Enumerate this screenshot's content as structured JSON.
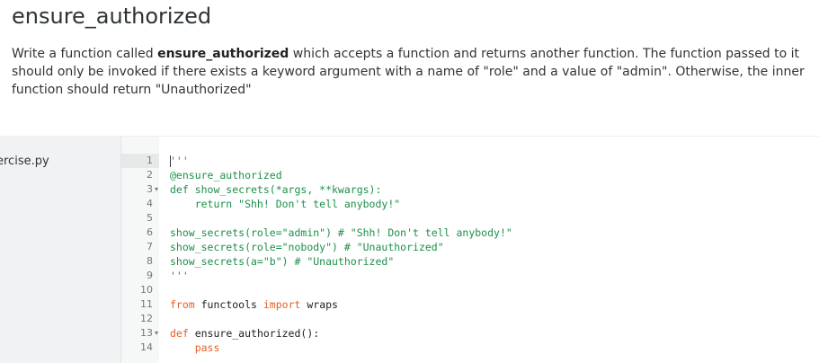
{
  "header": {
    "title": "ensure_authorized",
    "desc_prefix": "Write a function called ",
    "desc_bold": "ensure_authorized",
    "desc_rest": " which accepts a function and returns another function. The function passed to it should only be invoked if there exists a keyword argument with a name of \"role\" and a value of \"admin\". Otherwise, the inner function should return \"Unauthorized\""
  },
  "sidebar": {
    "file_name": "ercise.py"
  },
  "editor": {
    "active_line": 1,
    "lines": [
      {
        "n": "1",
        "fold": "",
        "segs": [
          {
            "t": "'''",
            "c": "g"
          }
        ]
      },
      {
        "n": "2",
        "fold": "",
        "segs": [
          {
            "t": "@ensure_authorized",
            "c": "g"
          }
        ]
      },
      {
        "n": "3",
        "fold": "▾",
        "segs": [
          {
            "t": "def show_secrets(*args, **kwargs):",
            "c": "g"
          }
        ]
      },
      {
        "n": "4",
        "fold": "",
        "segs": [
          {
            "t": "    return \"Shh! Don't tell anybody!\"",
            "c": "g"
          }
        ]
      },
      {
        "n": "5",
        "fold": "",
        "segs": []
      },
      {
        "n": "6",
        "fold": "",
        "segs": [
          {
            "t": "show_secrets(role=\"admin\") # \"Shh! Don't tell anybody!\"",
            "c": "g"
          }
        ]
      },
      {
        "n": "7",
        "fold": "",
        "segs": [
          {
            "t": "show_secrets(role=\"nobody\") # \"Unauthorized\"",
            "c": "g"
          }
        ]
      },
      {
        "n": "8",
        "fold": "",
        "segs": [
          {
            "t": "show_secrets(a=\"b\") # \"Unauthorized\"",
            "c": "g"
          }
        ]
      },
      {
        "n": "9",
        "fold": "",
        "segs": [
          {
            "t": "'''",
            "c": "g"
          }
        ]
      },
      {
        "n": "10",
        "fold": "",
        "segs": []
      },
      {
        "n": "11",
        "fold": "",
        "segs": [
          {
            "t": "from",
            "c": "o"
          },
          {
            "t": " functools ",
            "c": "k"
          },
          {
            "t": "import",
            "c": "o"
          },
          {
            "t": " wraps",
            "c": "k"
          }
        ]
      },
      {
        "n": "12",
        "fold": "",
        "segs": []
      },
      {
        "n": "13",
        "fold": "▾",
        "segs": [
          {
            "t": "def",
            "c": "o"
          },
          {
            "t": " ensure_authorized():",
            "c": "k"
          }
        ]
      },
      {
        "n": "14",
        "fold": "",
        "segs": [
          {
            "t": "    pass",
            "c": "o"
          }
        ]
      }
    ]
  },
  "colors": {
    "string_green": "#1d8f48",
    "keyword_orange": "#e85d23",
    "text_dark": "#222222"
  }
}
